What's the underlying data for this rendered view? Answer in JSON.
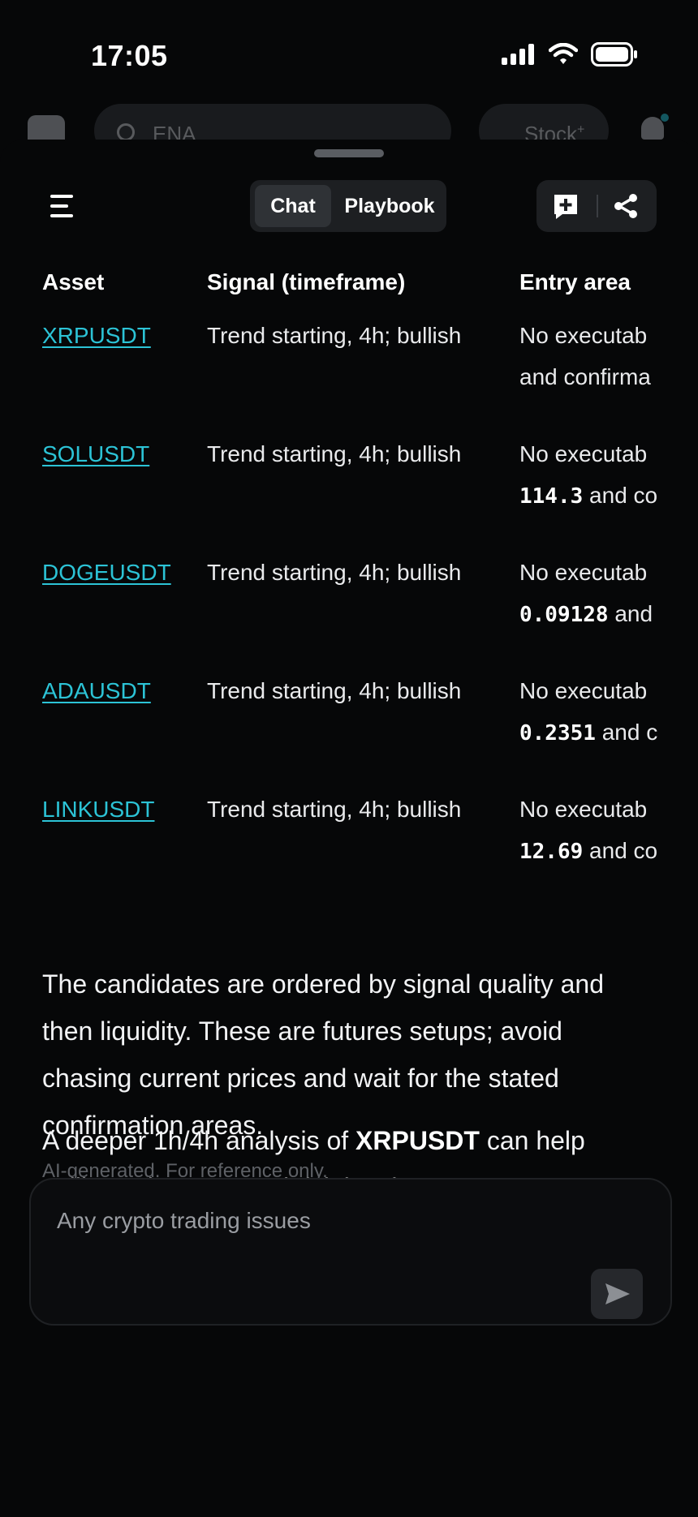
{
  "status_bar": {
    "time": "17:05"
  },
  "background_header": {
    "search_text": "ENA",
    "stock_label": "Stock",
    "stock_sup": "+"
  },
  "toolbar": {
    "tabs": [
      "Chat",
      "Playbook"
    ]
  },
  "table": {
    "headers": [
      "Asset",
      "Signal (timeframe)",
      "Entry area"
    ],
    "rows": [
      {
        "asset": "XRPUSDT",
        "signal": "Trend starting, 4h; bullish",
        "entry_line1": "No executab",
        "entry_value": "",
        "entry_line2": "and confirma"
      },
      {
        "asset": "SOLUSDT",
        "signal": "Trend starting, 4h; bullish",
        "entry_line1": "No executab",
        "entry_value": "114.3",
        "entry_line2": " and co"
      },
      {
        "asset": "DOGEUSDT",
        "signal": "Trend starting, 4h; bullish",
        "entry_line1": "No executab",
        "entry_value": "0.09128",
        "entry_line2": " and"
      },
      {
        "asset": "ADAUSDT",
        "signal": "Trend starting, 4h; bullish",
        "entry_line1": "No executab",
        "entry_value": "0.2351",
        "entry_line2": " and c"
      },
      {
        "asset": "LINKUSDT",
        "signal": "Trend starting, 4h; bullish",
        "entry_line1": "No executab",
        "entry_value": "12.69",
        "entry_line2": " and co"
      }
    ]
  },
  "message": {
    "paragraph1": "The candidates are ordered by signal quality and then liquidity. These are futures setups; avoid chasing current prices and wait for the stated confirmation areas.",
    "paragraph2_before": "A deeper 1h/4h analysis of ",
    "paragraph2_bold": "XRPUSDT",
    "paragraph2_after": " can help calibrate its entry and risk levels.",
    "disclaimer": "AI-generated. For reference only."
  },
  "composer": {
    "placeholder": "Any crypto trading issues"
  },
  "colors": {
    "background": "#060708",
    "link": "#2cc3d6",
    "panel": "#1d1f22"
  }
}
